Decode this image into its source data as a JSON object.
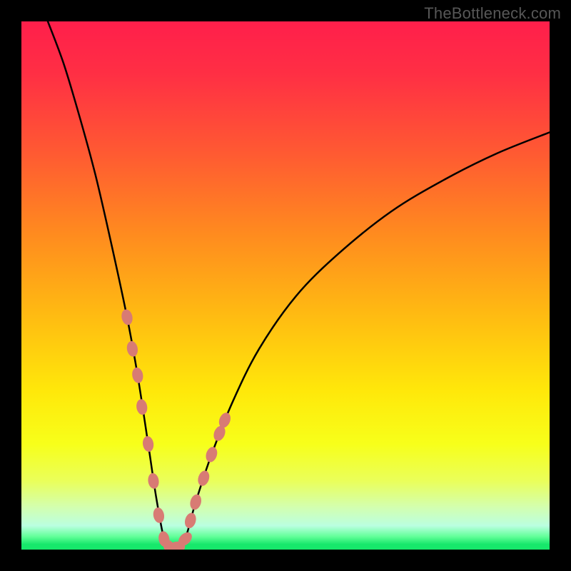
{
  "watermark": "TheBottleneck.com",
  "chart_data": {
    "type": "line",
    "title": "",
    "xlabel": "",
    "ylabel": "",
    "xlim": [
      0,
      100
    ],
    "ylim": [
      0,
      100
    ],
    "notch_x": 28,
    "curve": [
      {
        "x": 5.0,
        "y": 100.0
      },
      {
        "x": 8.0,
        "y": 92.0
      },
      {
        "x": 11.0,
        "y": 82.0
      },
      {
        "x": 14.0,
        "y": 71.0
      },
      {
        "x": 17.0,
        "y": 58.0
      },
      {
        "x": 20.0,
        "y": 44.0
      },
      {
        "x": 22.0,
        "y": 33.0
      },
      {
        "x": 24.0,
        "y": 20.0
      },
      {
        "x": 25.5,
        "y": 10.0
      },
      {
        "x": 27.0,
        "y": 2.0
      },
      {
        "x": 28.0,
        "y": 0.5
      },
      {
        "x": 29.5,
        "y": 0.5
      },
      {
        "x": 31.0,
        "y": 2.0
      },
      {
        "x": 33.0,
        "y": 9.0
      },
      {
        "x": 36.0,
        "y": 18.0
      },
      {
        "x": 40.0,
        "y": 28.0
      },
      {
        "x": 45.0,
        "y": 38.0
      },
      {
        "x": 52.0,
        "y": 48.0
      },
      {
        "x": 60.0,
        "y": 56.0
      },
      {
        "x": 70.0,
        "y": 64.0
      },
      {
        "x": 80.0,
        "y": 70.0
      },
      {
        "x": 90.0,
        "y": 75.0
      },
      {
        "x": 100.0,
        "y": 79.0
      }
    ],
    "markers": [
      {
        "x": 20.0,
        "y": 44.0
      },
      {
        "x": 21.0,
        "y": 38.0
      },
      {
        "x": 22.0,
        "y": 33.0
      },
      {
        "x": 22.8,
        "y": 27.0
      },
      {
        "x": 24.0,
        "y": 20.0
      },
      {
        "x": 25.0,
        "y": 13.0
      },
      {
        "x": 26.0,
        "y": 6.5
      },
      {
        "x": 27.0,
        "y": 2.0
      },
      {
        "x": 28.0,
        "y": 0.5
      },
      {
        "x": 29.5,
        "y": 0.5
      },
      {
        "x": 31.0,
        "y": 2.0
      },
      {
        "x": 32.0,
        "y": 5.5
      },
      {
        "x": 33.0,
        "y": 9.0
      },
      {
        "x": 34.5,
        "y": 13.5
      },
      {
        "x": 36.0,
        "y": 18.0
      },
      {
        "x": 37.5,
        "y": 22.0
      },
      {
        "x": 38.5,
        "y": 24.5
      }
    ],
    "gradient_stops": [
      {
        "offset": 0.0,
        "color": "#ff1f4b"
      },
      {
        "offset": 0.1,
        "color": "#ff2f44"
      },
      {
        "offset": 0.25,
        "color": "#ff5a32"
      },
      {
        "offset": 0.4,
        "color": "#ff8a1f"
      },
      {
        "offset": 0.55,
        "color": "#ffb912"
      },
      {
        "offset": 0.7,
        "color": "#ffe80a"
      },
      {
        "offset": 0.8,
        "color": "#f7ff1a"
      },
      {
        "offset": 0.87,
        "color": "#eaff5a"
      },
      {
        "offset": 0.92,
        "color": "#d3ffb0"
      },
      {
        "offset": 0.955,
        "color": "#baffe0"
      },
      {
        "offset": 0.975,
        "color": "#63ff9a"
      },
      {
        "offset": 0.99,
        "color": "#17e86b"
      },
      {
        "offset": 1.0,
        "color": "#17e86b"
      }
    ],
    "marker_color": "#d87b74",
    "curve_color": "#000000"
  }
}
